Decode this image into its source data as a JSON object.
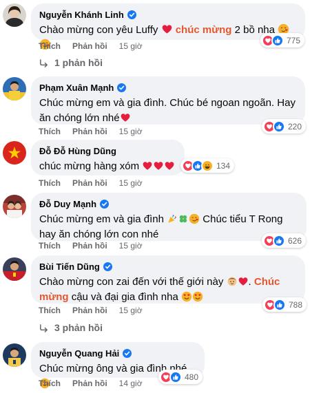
{
  "comments": [
    {
      "author": "Nguyễn Khánh Linh",
      "text_parts": [
        "Chào mừng con yêu Luffy ",
        " chúc mừng",
        " 2 bồ nha "
      ],
      "actions": {
        "like": "Thích",
        "reply": "Phản hồi",
        "time": "15 giờ"
      },
      "reaction_count": "775",
      "reactions": [
        "heart",
        "like"
      ],
      "replies_label": "1 phản hồi"
    },
    {
      "author": "Phạm Xuân Mạnh",
      "text_lines": [
        "Chúc mừng em và gia đình. Chúc bé ngoan ngoãn. Hay",
        "ăn chóng lớn nhé"
      ],
      "actions": {
        "like": "Thích",
        "reply": "Phản hồi",
        "time": "15 giờ"
      },
      "reaction_count": "220",
      "reactions": [
        "heart",
        "like"
      ]
    },
    {
      "author": "Đỗ Đỗ Hùng Dũng",
      "text": "chúc mừng hàng xóm ",
      "actions": {
        "like": "Thích",
        "reply": "Phản hồi",
        "time": "15 giờ"
      },
      "reaction_count": "134",
      "reactions": [
        "heart",
        "like",
        "haha"
      ]
    },
    {
      "author": "Đỗ Duy Mạnh",
      "text_lines": [
        "Chúc mừng em và gia đình ",
        " Chúc tiểu T Rong",
        "hay ăn chóng lớn con nhé"
      ],
      "actions": {
        "like": "Thích",
        "reply": "Phản hồi",
        "time": "15 giờ"
      },
      "reaction_count": "626",
      "reactions": [
        "heart",
        "like"
      ]
    },
    {
      "author": "Bùi Tiến Dũng",
      "text_parts": [
        "Chào mừng con zai đến với thế giới này ",
        ". ",
        "Chúc",
        "mừng",
        " cậu và đại gia đình nha "
      ],
      "actions": {
        "like": "Thích",
        "reply": "Phản hồi",
        "time": "15 giờ"
      },
      "reaction_count": "788",
      "reactions": [
        "heart",
        "like"
      ],
      "replies_label": "3 phản hồi"
    },
    {
      "author": "Nguyễn Quang Hải",
      "text": "Chúc mừng ông và gia đình nhé",
      "actions": {
        "like": "Thích",
        "reply": "Phản hồi",
        "time": "14 giờ"
      },
      "reaction_count": "480",
      "reactions": [
        "heart",
        "like"
      ]
    }
  ],
  "icons": {
    "verified": "verified-badge-icon",
    "reply_arrow": "reply-arrow-icon",
    "heart": "heart-reaction-icon",
    "like": "like-reaction-icon",
    "haha": "haha-reaction-icon"
  },
  "colors": {
    "bubble": "#f0f2f5",
    "verified": "#1877f2",
    "highlight": "#e4572e",
    "heart": "#f33e58",
    "like": "#1877f2",
    "meta_text": "#65676b"
  }
}
